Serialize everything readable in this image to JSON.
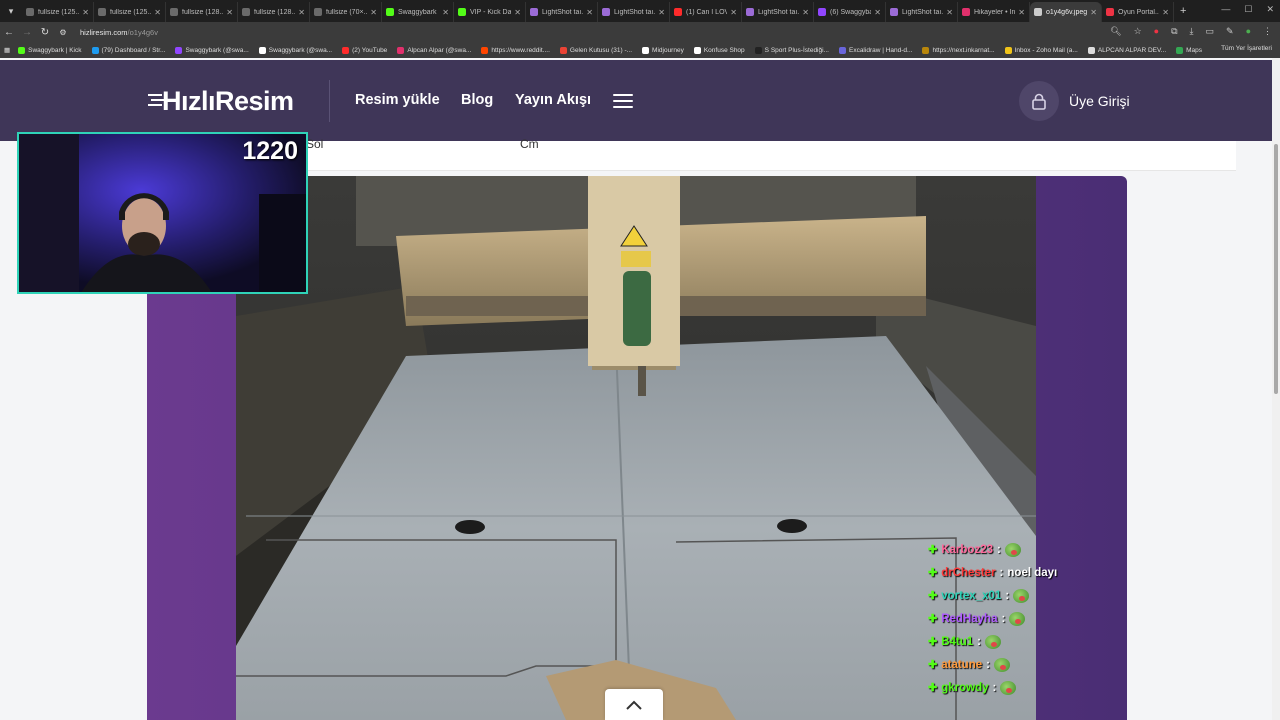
{
  "browser": {
    "tabs": [
      {
        "title": "fullsize (125...",
        "color": "#6a6a6a"
      },
      {
        "title": "fullsize (125...",
        "color": "#6a6a6a"
      },
      {
        "title": "fullsize (128...",
        "color": "#6a6a6a"
      },
      {
        "title": "fullsize (128...",
        "color": "#6a6a6a"
      },
      {
        "title": "fullsize (70×...",
        "color": "#6a6a6a"
      },
      {
        "title": "Swaggybark",
        "color": "#53fc18"
      },
      {
        "title": "VIP - Kick Da...",
        "color": "#53fc18"
      },
      {
        "title": "LightShot taı...",
        "color": "#9b6bd6"
      },
      {
        "title": "LightShot taı...",
        "color": "#9b6bd6"
      },
      {
        "title": "(1) Can I LOVE...",
        "color": "#ff2b2b"
      },
      {
        "title": "LightShot taı...",
        "color": "#9b6bd6"
      },
      {
        "title": "(6) Swaggyba...",
        "color": "#9146ff"
      },
      {
        "title": "LightShot taı...",
        "color": "#9b6bd6"
      },
      {
        "title": "Hikayeler • In...",
        "color": "#e1306c"
      },
      {
        "title": "o1y4g6v.jpeg",
        "color": "#cccccc",
        "active": true
      },
      {
        "title": "Oyun Portal...",
        "color": "#e34"
      }
    ],
    "url_host": "hizliresim.com",
    "url_path": "/o1y4g6v",
    "bookmarks": [
      {
        "label": "Swaggybark | Kick",
        "color": "#53fc18"
      },
      {
        "label": "(79) Dashboard / Str...",
        "color": "#1d9bf0"
      },
      {
        "label": "Swaggybark (@swa...",
        "color": "#9146ff"
      },
      {
        "label": "Swaggybark (@swa...",
        "color": "#ffffff"
      },
      {
        "label": "(2) YouTube",
        "color": "#ff2b2b"
      },
      {
        "label": "Alpcan Alpar (@swa...",
        "color": "#e1306c"
      },
      {
        "label": "https://www.reddit....",
        "color": "#ff4500"
      },
      {
        "label": "Gelen Kutusu (31) -...",
        "color": "#ea4335"
      },
      {
        "label": "Midjourney",
        "color": "#ffffff"
      },
      {
        "label": "Konfuse Shop",
        "color": "#ffffff"
      },
      {
        "label": "S Sport Plus-İstediği...",
        "color": "#222"
      },
      {
        "label": "Excalidraw | Hand-d...",
        "color": "#6965db"
      },
      {
        "label": "https://next.inkarnat...",
        "color": "#b8860b"
      },
      {
        "label": "Inbox - Zoho Mail (a...",
        "color": "#f0c419"
      },
      {
        "label": "ALPCAN ALPAR DEV...",
        "color": "#dddddd"
      },
      {
        "label": "Maps",
        "color": "#34a853"
      }
    ],
    "bookmarks_right": "Tüm Yer İşaretleri"
  },
  "site": {
    "logo_text": "HızlıResim",
    "nav": {
      "upload": "Resim yükle",
      "blog": "Blog",
      "feed": "Yayın Akışı"
    },
    "login": "Üye Girişi",
    "strip_left": "Sol",
    "strip_right": "Cm"
  },
  "stream": {
    "counter": "1220",
    "chat": [
      {
        "user": "Karboz23",
        "color": "#ff6b9d",
        "msg": "",
        "emote": true
      },
      {
        "user": "drChester",
        "color": "#ff3b3b",
        "msg": "noel dayı",
        "emote": false
      },
      {
        "user": "vortex_x01",
        "color": "#2fd3b8",
        "msg": "",
        "emote": true
      },
      {
        "user": "RedHayha",
        "color": "#b05cff",
        "msg": "",
        "emote": true
      },
      {
        "user": "B4tu1",
        "color": "#53fc18",
        "msg": "",
        "emote": true
      },
      {
        "user": "atatune",
        "color": "#ff9a3c",
        "msg": "",
        "emote": true
      },
      {
        "user": "gkrowdy",
        "color": "#53fc18",
        "msg": "",
        "emote": true
      }
    ]
  },
  "colors": {
    "header_bg": "#3f3658",
    "frame_purple": "#5a3482",
    "webcam_border": "#2fd3b8"
  }
}
